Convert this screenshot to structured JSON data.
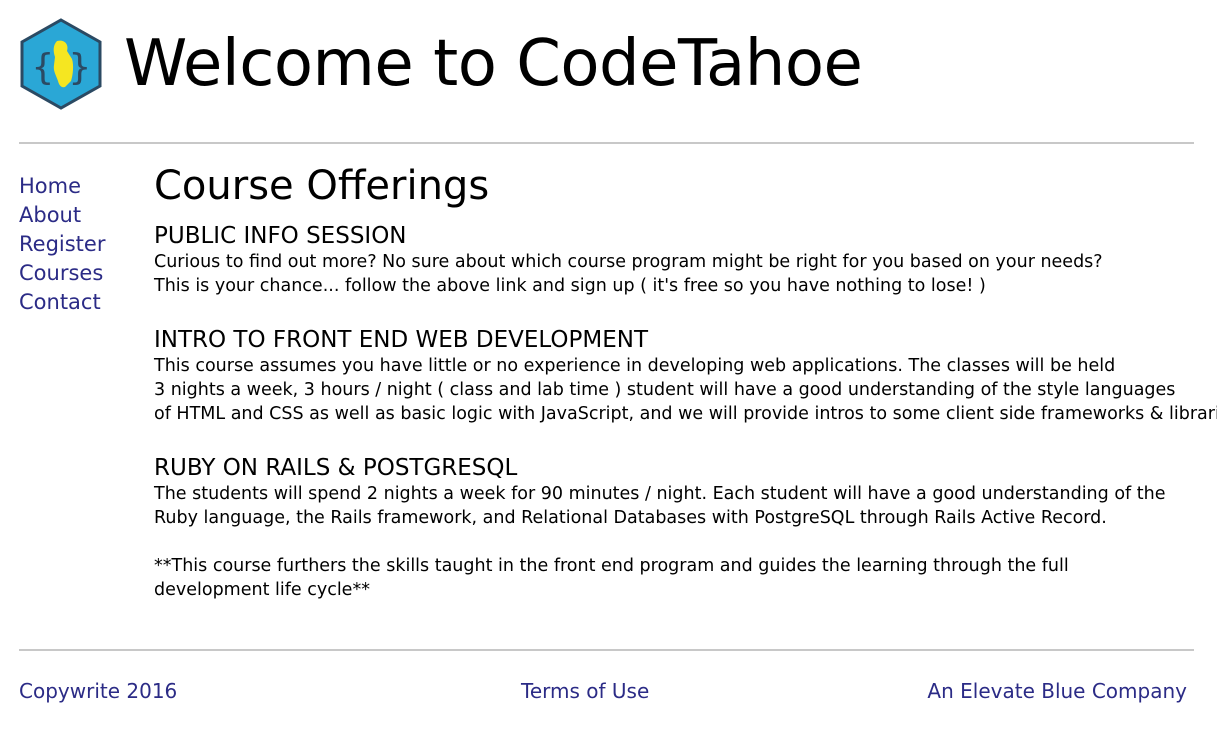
{
  "header": {
    "title": "Welcome to CodeTahoe",
    "logo_icon": "codetahoe-hexagon-logo"
  },
  "nav": {
    "items": [
      {
        "label": "Home"
      },
      {
        "label": "About"
      },
      {
        "label": "Register"
      },
      {
        "label": "Courses"
      },
      {
        "label": "Contact"
      }
    ]
  },
  "main": {
    "title": "Course Offerings",
    "sections": [
      {
        "title": "PUBLIC INFO SESSION",
        "lines": [
          "Curious to find out more? No sure about which course program might be right for you based on your needs?",
          "This is your chance... follow the above link and sign up ( it's free so you have nothing to lose! )"
        ]
      },
      {
        "title": "INTRO TO FRONT END WEB DEVELOPMENT",
        "lines": [
          "This course assumes you have little or no experience in developing web applications. The classes will be held",
          "3 nights a week, 3 hours / night ( class and lab time ) student will have a good understanding of the style languages",
          "of HTML and CSS as well as basic logic with JavaScript, and we will provide intros to some client side frameworks & libraries."
        ]
      },
      {
        "title": "RUBY ON RAILS & POSTGRESQL",
        "lines": [
          "The students will spend 2 nights a week for 90 minutes / night. Each student will have a good understanding of the",
          "Ruby language, the Rails framework, and Relational Databases with PostgreSQL through Rails Active Record."
        ],
        "note_lines": [
          "**This course furthers the skills taught in the front end program and guides the learning through the full",
          "development life cycle**"
        ]
      }
    ]
  },
  "footer": {
    "copyright": "Copywrite 2016",
    "terms": "Terms of Use",
    "company": "An Elevate Blue Company"
  },
  "colors": {
    "link": "#2b2b86",
    "logo_hex": "#2aa7d6",
    "logo_outline": "#2b4a63",
    "logo_lake": "#f5e621",
    "divider": "#c8c8c8"
  }
}
